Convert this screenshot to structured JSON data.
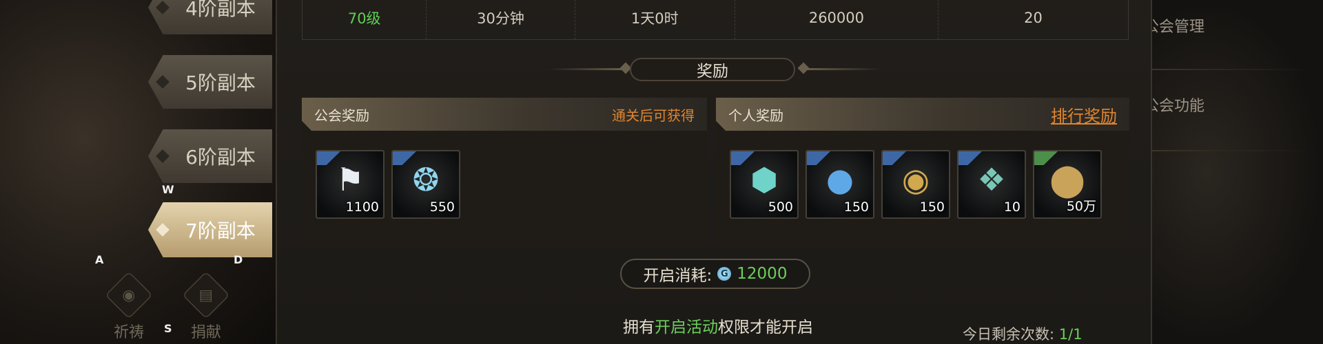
{
  "tiers": [
    {
      "label": "4阶副本",
      "selected": false
    },
    {
      "label": "5阶副本",
      "selected": false
    },
    {
      "label": "6阶副本",
      "selected": false
    },
    {
      "label": "7阶副本",
      "selected": true
    }
  ],
  "key_hints": {
    "w": "W",
    "a": "A",
    "s": "S",
    "d": "D"
  },
  "bottom_buttons": [
    {
      "label": "祈祷",
      "icon": "eye-icon"
    },
    {
      "label": "捐献",
      "icon": "book-icon"
    }
  ],
  "info_row": [
    "70级",
    "30分钟",
    "1天0时",
    "260000",
    "20"
  ],
  "reward_title": "奖励",
  "guild_reward": {
    "title": "公会奖励",
    "note": "通关后可获得",
    "items": [
      {
        "icon": "guild-flag-icon",
        "qty": "1100",
        "corner": "blue"
      },
      {
        "icon": "guild-medal-icon",
        "qty": "550",
        "corner": "blue"
      }
    ]
  },
  "personal_reward": {
    "title": "个人奖励",
    "rank_link": "排行奖励",
    "items": [
      {
        "icon": "hex-gem-icon",
        "qty": "500",
        "corner": "blue"
      },
      {
        "icon": "blue-orbs-icon",
        "qty": "150",
        "corner": "blue"
      },
      {
        "icon": "orb-coin-icon",
        "qty": "150",
        "corner": "blue"
      },
      {
        "icon": "crystal-shard-icon",
        "qty": "10",
        "corner": "blue"
      },
      {
        "icon": "gold-coin-icon",
        "qty": "50万",
        "corner": "green"
      }
    ]
  },
  "cost": {
    "label": "开启消耗:",
    "coin_letter": "G",
    "value": "12000"
  },
  "permission": {
    "prefix": "拥有",
    "highlight": "开启活动",
    "suffix": "权限才能开启"
  },
  "remaining": {
    "label": "今日剩余次数:",
    "value": "1/1"
  },
  "right_menu": [
    "公会管理",
    "公会功能"
  ],
  "colors": {
    "accent_green": "#6ccf5b",
    "accent_orange": "#e0862f",
    "selected_tab": "#d9c59b"
  }
}
